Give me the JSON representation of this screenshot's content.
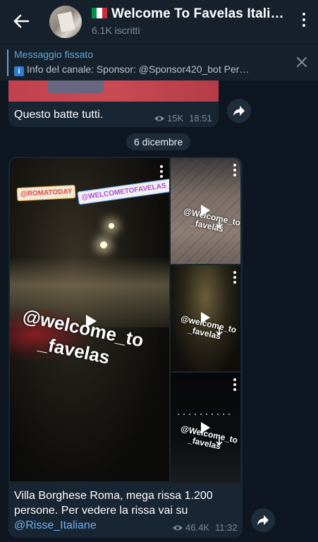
{
  "header": {
    "title": "Welcome To Favelas Itali…",
    "subtitle": "6.1K iscritti",
    "flag_colors": [
      "#009246",
      "#ffffff",
      "#ce2b37"
    ]
  },
  "pinned": {
    "title": "Messaggio fissato",
    "text": "Info del canale:  Sponsor:  @Sponsor420_bot  Per…",
    "icon": "info-icon"
  },
  "messages": [
    {
      "text": "Questo batte tutti.",
      "views": "15K",
      "time": "18:51"
    }
  ],
  "date_separator": "6 dicembre",
  "album": {
    "tags": [
      "@ROMATODAY",
      "@WELCOMETOFAVELAS_"
    ],
    "watermark_line1": "@welcome_to",
    "watermark_line2": "_favelas",
    "side_watermark_1a": "@Welcome_to",
    "side_watermark_1b": "_favelas",
    "side_watermark_2a": "@welcome_to",
    "side_watermark_2b": "_favelas",
    "side_watermark_3a": "@Welcome_to",
    "side_watermark_3b": "_favelas",
    "caption_text": "Villa Borghese Roma, mega rissa 1.200 persone. Per vedere la rissa vai su",
    "caption_link": "@Risse_Italiane",
    "views": "46.4K",
    "time": "11:32"
  },
  "colors": {
    "background": "#0e1621",
    "header": "#17212b",
    "bubble": "#182533",
    "link": "#6ab2f2",
    "pinned_accent": "#5fa8e0",
    "meta": "#7d8b99"
  }
}
